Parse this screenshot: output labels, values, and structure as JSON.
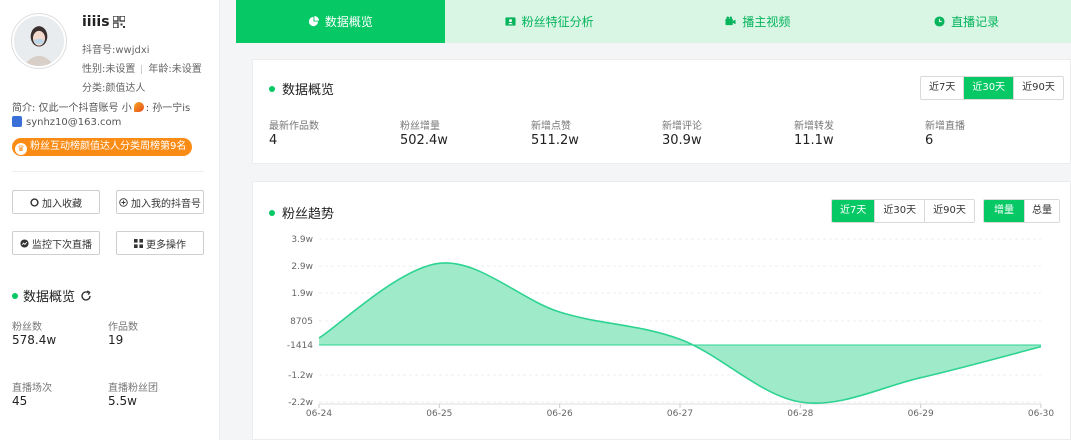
{
  "profile": {
    "nickname": "iiiis",
    "douyin_id": "抖音号:wwjdxi",
    "gender": "性别:未设置",
    "age": "年龄:未设置",
    "category": "分类:颜值达人",
    "bio_prefix": "简介: 仅此一个抖音账号 小",
    "bio_suffix": ":  孙一宁is",
    "email": "synhz10@163.com",
    "rank_badge": "粉丝互动榜颜值达人分类周榜第9名"
  },
  "sidebar": {
    "buttons": {
      "favorite": "加入收藏",
      "add_mine": "加入我的抖音号",
      "monitor_live": "监控下次直播",
      "more": "更多操作"
    },
    "overview_title": "数据概览",
    "stats": [
      {
        "label": "粉丝数",
        "value": "578.4w"
      },
      {
        "label": "作品数",
        "value": "19"
      },
      {
        "label": "直播场次",
        "value": "45"
      },
      {
        "label": "直播粉丝团",
        "value": "5.5w"
      }
    ]
  },
  "tabs": [
    {
      "label": "数据概览",
      "active": true
    },
    {
      "label": "粉丝特征分析",
      "active": false
    },
    {
      "label": "播主视频",
      "active": false
    },
    {
      "label": "直播记录",
      "active": false
    }
  ],
  "overview": {
    "title": "数据概览",
    "ranges": [
      "近7天",
      "近30天",
      "近90天"
    ],
    "active_range": "近30天",
    "metrics": [
      {
        "label": "最新作品数",
        "value": "4"
      },
      {
        "label": "粉丝增量",
        "value": "502.4w"
      },
      {
        "label": "新增点赞",
        "value": "511.2w"
      },
      {
        "label": "新增评论",
        "value": "30.9w"
      },
      {
        "label": "新增转发",
        "value": "11.1w"
      },
      {
        "label": "新增直播",
        "value": "6"
      }
    ]
  },
  "trend": {
    "title": "粉丝趋势",
    "ranges": [
      "近7天",
      "近30天",
      "近90天"
    ],
    "active_range": "近7天",
    "modes": [
      "增量",
      "总量"
    ],
    "active_mode": "增量"
  },
  "colors": {
    "accent": "#06c865",
    "line": "#2ed392",
    "fill": "#8ee8c0"
  },
  "chart_data": {
    "type": "area",
    "categories": [
      "06-24",
      "06-25",
      "06-26",
      "06-27",
      "06-28",
      "06-29",
      "06-30"
    ],
    "values": [
      1500,
      30000,
      12000,
      1000,
      -22000,
      -13000,
      -2000
    ],
    "y_ticks": [
      "3.9w",
      "2.9w",
      "1.9w",
      "8705",
      "-1414",
      "-1.2w",
      "-2.2w"
    ],
    "y_tick_values": [
      39000,
      29000,
      19000,
      8705,
      -1414,
      -12000,
      -22000
    ],
    "ylim": [
      -22000,
      39000
    ],
    "grid": true,
    "baseline": -1414
  }
}
